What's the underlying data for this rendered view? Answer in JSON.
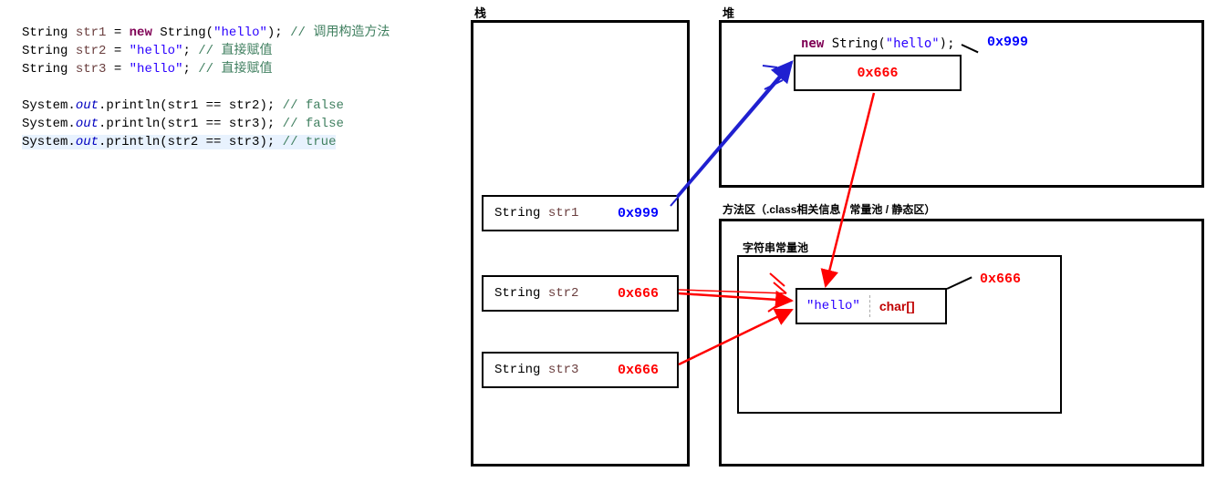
{
  "code": {
    "line1": {
      "type": "String",
      "var": "str1",
      "eq": " = ",
      "new": "new ",
      "call": "String(",
      "lit": "\"hello\"",
      "close": "); ",
      "cm": "// 调用构造方法"
    },
    "line2": {
      "type": "String",
      "var": "str2",
      "eq": " = ",
      "lit": "\"hello\"",
      "close": "; ",
      "cm": "// 直接赋值"
    },
    "line3": {
      "type": "String",
      "var": "str3",
      "eq": " = ",
      "lit": "\"hello\"",
      "close": "; ",
      "cm": "// 直接赋值"
    },
    "line4": {
      "sys": "System.",
      "out": "out",
      "rest": ".println(str1 == str2); ",
      "cm": "// false"
    },
    "line5": {
      "sys": "System.",
      "out": "out",
      "rest": ".println(str1 == str3); ",
      "cm": "// false"
    },
    "line6": {
      "sys": "System.",
      "out": "out",
      "rest": ".println(str2 == str3); ",
      "cm": "// true"
    }
  },
  "headings": {
    "stack": "栈",
    "heap": "堆",
    "method": "方法区（.class相关信息 / 常量池 / 静态区）",
    "pool": "字符串常量池"
  },
  "stack": {
    "s1": {
      "type": "String ",
      "var": "str1",
      "addr": "0x999"
    },
    "s2": {
      "type": "String ",
      "var": "str2",
      "addr": "0x666"
    },
    "s3": {
      "type": "String ",
      "var": "str3",
      "addr": "0x666"
    }
  },
  "heap": {
    "new_kw": "new ",
    "call": "String(",
    "lit": "\"hello\"",
    "close": ");",
    "addr": "0x999",
    "inner_addr": "0x666"
  },
  "pool": {
    "lit": "\"hello\"",
    "type": "char[]",
    "addr": "0x666"
  }
}
